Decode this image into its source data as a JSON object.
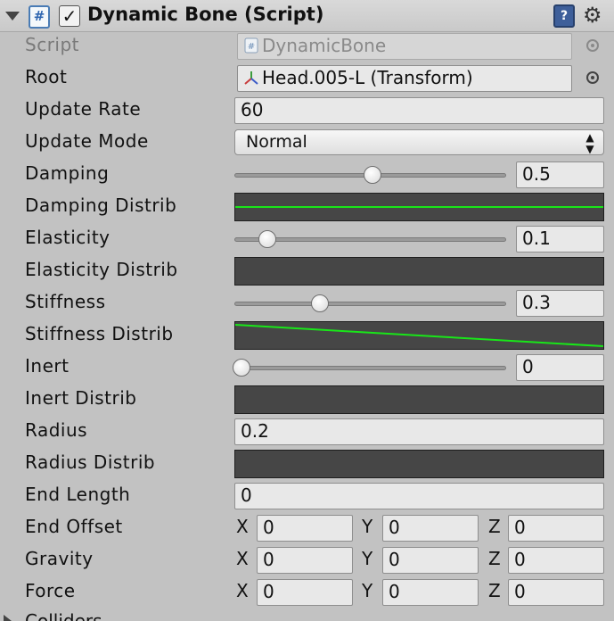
{
  "header": {
    "title": "Dynamic Bone (Script)",
    "script_icon_glyph": "#",
    "help_icon_glyph": "?",
    "gear_glyph": "⚙",
    "enabled": true
  },
  "fields": {
    "script": {
      "label": "Script",
      "value": "DynamicBone"
    },
    "root": {
      "label": "Root",
      "value": "Head.005-L (Transform)"
    },
    "update_rate": {
      "label": "Update Rate",
      "value": "60"
    },
    "update_mode": {
      "label": "Update Mode",
      "value": "Normal",
      "arrows": "▲\n▼"
    },
    "damping": {
      "label": "Damping",
      "value": "0.5",
      "fraction": 0.5
    },
    "damping_distrib": {
      "label": "Damping Distrib"
    },
    "elasticity": {
      "label": "Elasticity",
      "value": "0.1",
      "fraction": 0.1
    },
    "elasticity_distrib": {
      "label": "Elasticity Distrib"
    },
    "stiffness": {
      "label": "Stiffness",
      "value": "0.3",
      "fraction": 0.3
    },
    "stiffness_distrib": {
      "label": "Stiffness Distrib"
    },
    "inert": {
      "label": "Inert",
      "value": "0",
      "fraction": 0
    },
    "inert_distrib": {
      "label": "Inert Distrib"
    },
    "radius": {
      "label": "Radius",
      "value": "0.2"
    },
    "radius_distrib": {
      "label": "Radius Distrib"
    },
    "end_length": {
      "label": "End Length",
      "value": "0"
    },
    "end_offset": {
      "label": "End Offset",
      "x": "0",
      "y": "0",
      "z": "0"
    },
    "gravity": {
      "label": "Gravity",
      "x": "0",
      "y": "0",
      "z": "0"
    },
    "force": {
      "label": "Force",
      "x": "0",
      "y": "0",
      "z": "0"
    },
    "colliders": {
      "label": "Colliders"
    }
  },
  "axis_labels": {
    "x": "X",
    "y": "Y",
    "z": "Z"
  },
  "colors": {
    "curve_line": "#19e619",
    "curve_bg": "#464646",
    "panel_bg": "#c2c2c2"
  }
}
